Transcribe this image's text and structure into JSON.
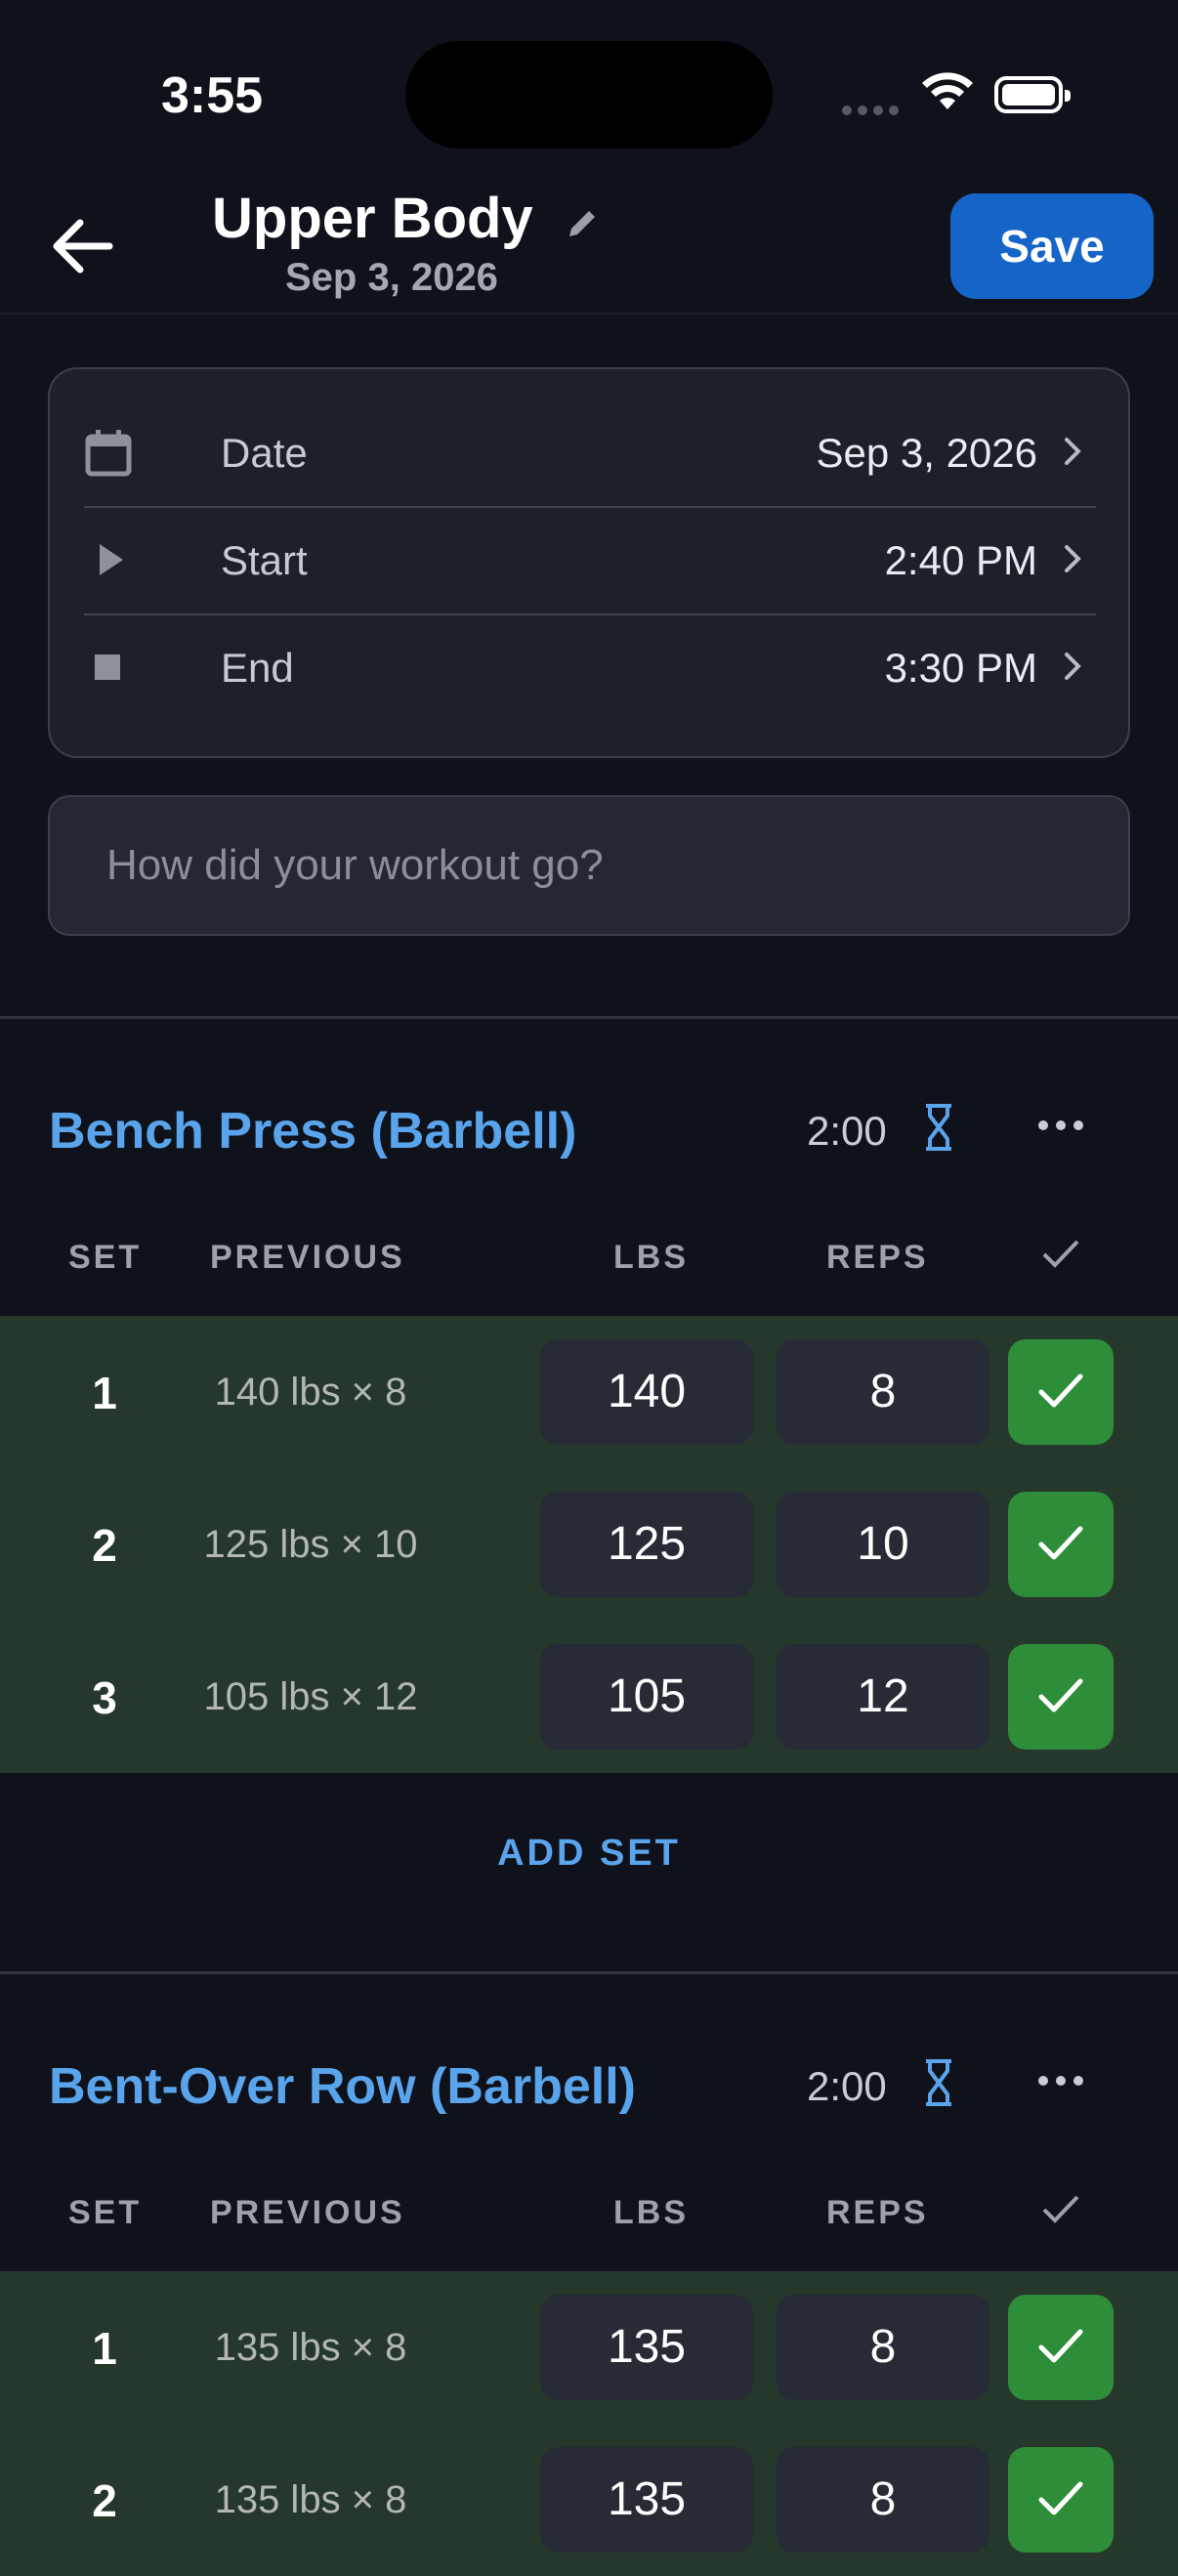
{
  "status_bar": {
    "time": "3:55"
  },
  "header": {
    "title": "Upper Body",
    "subtitle": "Sep 3, 2026",
    "save_label": "Save"
  },
  "time_card": {
    "rows": [
      {
        "label": "Date",
        "value": "Sep 3, 2026",
        "icon": "calendar-icon"
      },
      {
        "label": "Start",
        "value": "2:40 PM",
        "icon": "play-icon"
      },
      {
        "label": "End",
        "value": "3:30 PM",
        "icon": "stop-icon"
      }
    ]
  },
  "notes": {
    "placeholder": "How did your workout go?"
  },
  "columns": {
    "set": "SET",
    "previous": "PREVIOUS",
    "lbs": "LBS",
    "reps": "REPS"
  },
  "exercises": [
    {
      "name": "Bench Press (Barbell)",
      "rest_timer": "2:00",
      "add_set_label": "ADD SET",
      "sets": [
        {
          "set": "1",
          "previous": "140 lbs × 8",
          "lbs": "140",
          "reps": "8",
          "completed": true
        },
        {
          "set": "2",
          "previous": "125 lbs × 10",
          "lbs": "125",
          "reps": "10",
          "completed": true
        },
        {
          "set": "3",
          "previous": "105 lbs × 12",
          "lbs": "105",
          "reps": "12",
          "completed": true
        }
      ]
    },
    {
      "name": "Bent-Over Row (Barbell)",
      "rest_timer": "2:00",
      "sets": [
        {
          "set": "1",
          "previous": "135 lbs × 8",
          "lbs": "135",
          "reps": "8",
          "completed": true
        },
        {
          "set": "2",
          "previous": "135 lbs × 8",
          "lbs": "135",
          "reps": "8",
          "completed": true
        }
      ]
    }
  ],
  "colors": {
    "background": "#0f121a",
    "accent_blue": "#5aa4ec",
    "save_button": "#1565c8",
    "completed_row": "#26372c",
    "completed_check": "#2e8d38"
  }
}
